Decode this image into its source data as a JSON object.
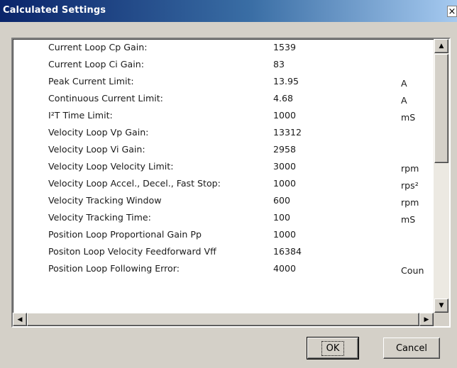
{
  "window": {
    "title": "Calculated Settings",
    "close_glyph": "×"
  },
  "rows": [
    {
      "label": "Current Loop Cp Gain:",
      "value": "1539",
      "unit": ""
    },
    {
      "label": "Current Loop Ci Gain:",
      "value": "83",
      "unit": ""
    },
    {
      "label": "Peak Current Limit:",
      "value": "13.95",
      "unit": "A"
    },
    {
      "label": "Continuous Current Limit:",
      "value": "4.68",
      "unit": "A"
    },
    {
      "label": "I²T Time Limit:",
      "value": "1000",
      "unit": "mS"
    },
    {
      "label": "Velocity Loop Vp Gain:",
      "value": "13312",
      "unit": ""
    },
    {
      "label": "Velocity Loop Vi Gain:",
      "value": "2958",
      "unit": ""
    },
    {
      "label": "Velocity Loop Velocity Limit:",
      "value": "3000",
      "unit": "rpm"
    },
    {
      "label": "Velocity Loop Accel., Decel., Fast Stop:",
      "value": "1000",
      "unit": "rps²"
    },
    {
      "label": "Velocity Tracking Window",
      "value": "600",
      "unit": "rpm"
    },
    {
      "label": "Velocity Tracking Time:",
      "value": "100",
      "unit": "mS"
    },
    {
      "label": "Position Loop Proportional Gain Pp",
      "value": "1000",
      "unit": ""
    },
    {
      "label": "Positon Loop Velocity Feedforward Vff",
      "value": "16384",
      "unit": ""
    },
    {
      "label": "Position Loop Following Error:",
      "value": "4000",
      "unit": "Coun"
    }
  ],
  "scroll": {
    "up_glyph": "▲",
    "down_glyph": "▼",
    "left_glyph": "◀",
    "right_glyph": "▶"
  },
  "buttons": {
    "ok_label": "OK",
    "cancel_label": "Cancel"
  },
  "icons": {
    "close": "close-icon",
    "scroll_up": "arrow-up-icon",
    "scroll_down": "arrow-down-icon",
    "scroll_left": "arrow-left-icon",
    "scroll_right": "arrow-right-icon"
  },
  "colors": {
    "title_start": "#0a246a",
    "title_end": "#a6caf0",
    "face": "#d4d0c8",
    "panel": "#ffffff"
  }
}
